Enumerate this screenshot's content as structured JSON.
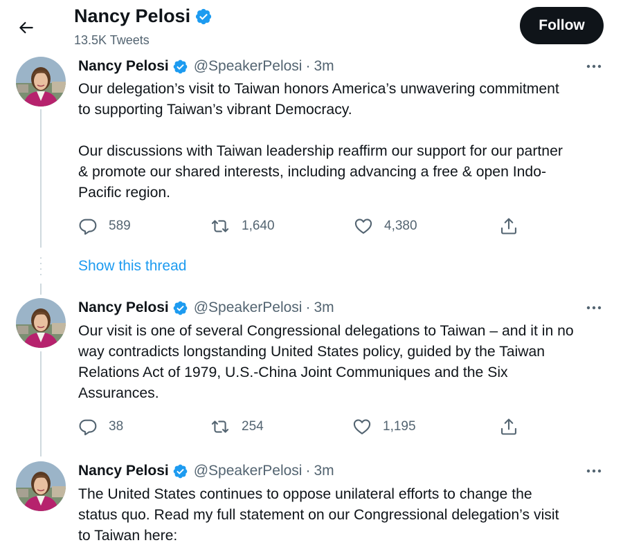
{
  "header": {
    "title": "Nancy Pelosi",
    "tweet_count": "13.5K Tweets",
    "follow_label": "Follow"
  },
  "show_thread_label": "Show this thread",
  "colors": {
    "accent": "#1d9bf0",
    "text": "#0f1419",
    "secondary": "#536471",
    "verified": "#1d9bf0",
    "follow_bg": "#0f1419"
  },
  "tweets": [
    {
      "name": "Nancy Pelosi",
      "handle": "@SpeakerPelosi",
      "dot": "·",
      "time": "3m",
      "lines": [
        "Our delegation’s visit to Taiwan honors America’s unwavering commitment",
        "to supporting Taiwan’s vibrant Democracy.",
        "",
        "Our discussions with Taiwan leadership reaffirm our support for our partner",
        "& promote our shared interests, including advancing a free & open Indo-",
        "Pacific region."
      ],
      "replies": "589",
      "retweets": "1,640",
      "likes": "4,380"
    },
    {
      "name": "Nancy Pelosi",
      "handle": "@SpeakerPelosi",
      "dot": "·",
      "time": "3m",
      "lines": [
        "Our visit is one of several Congressional delegations to Taiwan – and it in no",
        "way contradicts longstanding United States policy, guided by the Taiwan",
        "Relations Act of 1979, U.S.-China Joint Communiques and the Six",
        "Assurances."
      ],
      "replies": "38",
      "retweets": "254",
      "likes": "1,195"
    },
    {
      "name": "Nancy Pelosi",
      "handle": "@SpeakerPelosi",
      "dot": "·",
      "time": "3m",
      "lines": [
        "The United States continues to oppose unilateral efforts to change the",
        "status quo. Read my full statement on our Congressional delegation’s visit",
        "to Taiwan here:"
      ]
    }
  ],
  "icons": {
    "back": "arrow-left-icon",
    "verified": "verified-badge-icon",
    "more": "more-horizontal-icon",
    "reply": "reply-icon",
    "retweet": "retweet-icon",
    "like": "heart-icon",
    "share": "share-icon"
  }
}
